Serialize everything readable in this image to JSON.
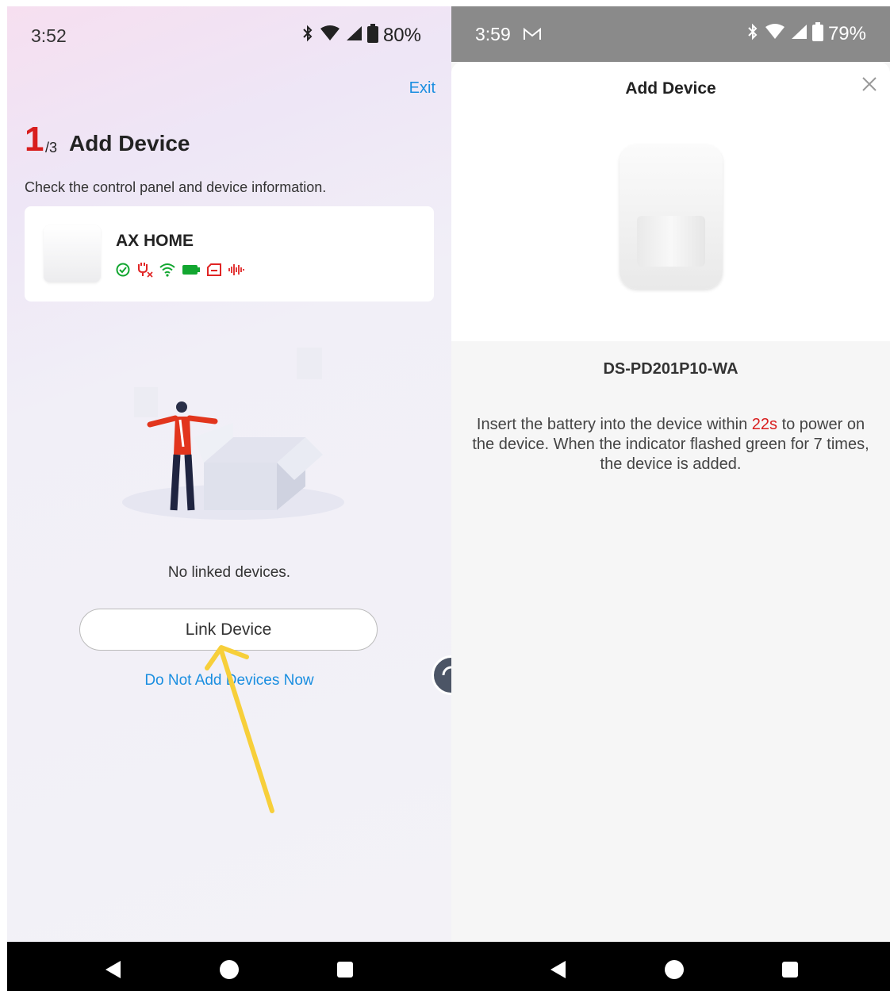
{
  "left": {
    "status": {
      "time": "3:52",
      "battery": "80%"
    },
    "exit_label": "Exit",
    "step": {
      "current": "1",
      "total": "/3"
    },
    "title": "Add Device",
    "subtitle": "Check the control panel and device information.",
    "panel": {
      "name": "AX HOME",
      "status_icons": [
        "check-circle-icon",
        "power-off-icon",
        "wifi-icon",
        "battery-icon",
        "sim-icon",
        "signal-wave-icon"
      ]
    },
    "empty_text": "No linked devices.",
    "link_button": "Link Device",
    "skip_link": "Do Not Add Devices Now"
  },
  "right": {
    "status": {
      "time": "3:59",
      "battery": "79%"
    },
    "title": "Add Device",
    "model": "DS-PD201P10-WA",
    "instruction": {
      "before": "Insert the battery into the device within ",
      "highlight": "22s",
      "after": " to power on the device. When the indicator flashed green for 7 times, the device is added."
    }
  },
  "colors": {
    "accent_red": "#d81e1e",
    "link_blue": "#1a8ee0",
    "status_green": "#12a630",
    "status_red": "#e02424"
  }
}
